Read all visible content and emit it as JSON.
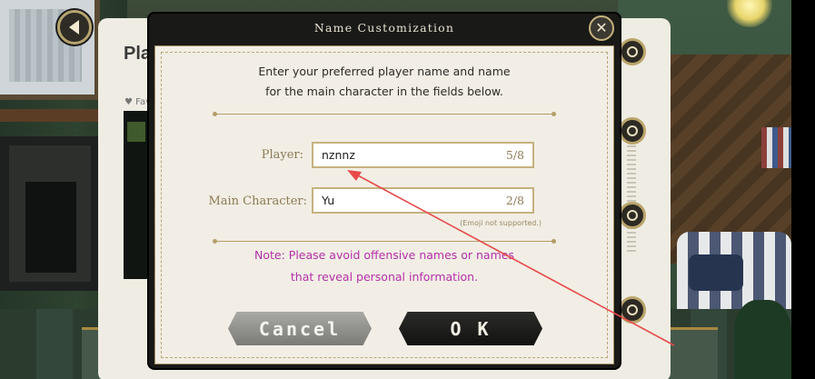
{
  "background": {
    "panel_title": "Pla",
    "favorites_label": "♥ Fav"
  },
  "dialog": {
    "title": "Name Customization",
    "intro_line1": "Enter your preferred player name and name",
    "intro_line2": "for the main character in the fields below.",
    "player": {
      "label": "Player:",
      "value": "nznnz",
      "count": "5/8"
    },
    "main_character": {
      "label": "Main Character:",
      "value": "Yu",
      "count": "2/8"
    },
    "emoji_note": "(Emoji not supported.)",
    "note_line1": "Note: Please avoid offensive names or names",
    "note_line2": "that reveal personal information.",
    "cancel_label": "Cancel",
    "ok_label": "O K"
  },
  "icons": {
    "back": "back-arrow-icon",
    "close": "close-icon",
    "gear": "gear-icon"
  },
  "colors": {
    "note_text": "#b52fa8",
    "field_border": "#c6b27e",
    "annotation_arrow": "#e84a4a"
  }
}
